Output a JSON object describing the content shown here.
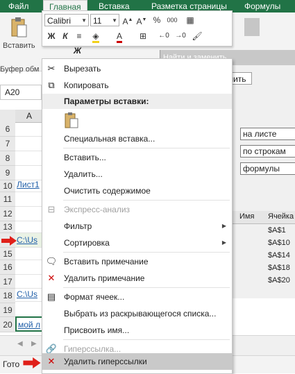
{
  "ribbon": {
    "tabs": [
      "Файл",
      "Главная",
      "Вставка",
      "Разметка страницы",
      "Формулы"
    ],
    "active_tab": "Главная",
    "paste_label": "Вставить",
    "clipboard_group": "Буфер обм"
  },
  "minibar": {
    "font_name": "Calibri",
    "font_size": "11",
    "bold": "Ж",
    "italic": "К",
    "italic2": "Ж",
    "percent": "%",
    "thousands": "000"
  },
  "namebox": {
    "value": "A20"
  },
  "dialog": {
    "title": "Найти и заменить",
    "tab_replace": "нить",
    "field_within": "на листе",
    "field_search": "по строкам",
    "field_lookin": "формулы",
    "col_name": "Имя",
    "col_cell": "Ячейка",
    "results": [
      "$A$1",
      "$A$10",
      "$A$14",
      "$A$18",
      "$A$20"
    ]
  },
  "grid": {
    "col_header": "A",
    "rows": [
      {
        "num": "6",
        "text": ""
      },
      {
        "num": "7",
        "text": ""
      },
      {
        "num": "8",
        "text": ""
      },
      {
        "num": "9",
        "text": ""
      },
      {
        "num": "10",
        "text": "Лист1"
      },
      {
        "num": "11",
        "text": ""
      },
      {
        "num": "12",
        "text": ""
      },
      {
        "num": "13",
        "text": ""
      },
      {
        "num": "14",
        "text": "C:\\Us"
      },
      {
        "num": "15",
        "text": ""
      },
      {
        "num": "16",
        "text": ""
      },
      {
        "num": "17",
        "text": ""
      },
      {
        "num": "18",
        "text": "C:\\Us"
      },
      {
        "num": "19",
        "text": ""
      },
      {
        "num": "20",
        "text": "мой л"
      }
    ]
  },
  "menu": {
    "cut": "Вырезать",
    "copy": "Копировать",
    "paste_options": "Параметры вставки:",
    "paste_special": "Специальная вставка...",
    "insert": "Вставить...",
    "delete": "Удалить...",
    "clear": "Очистить содержимое",
    "quick_analysis": "Экспресс-анализ",
    "filter": "Фильтр",
    "sort": "Сортировка",
    "insert_comment": "Вставить примечание",
    "delete_comment": "Удалить примечание",
    "format_cells": "Формат ячеек...",
    "pick_list": "Выбрать из раскрывающегося списка...",
    "define_name": "Присвоить имя...",
    "hyperlink": "Гиперссылка...",
    "remove_hyperlinks": "Удалить гиперссылки"
  },
  "status": {
    "text": "Гото"
  },
  "colors": {
    "excel_green": "#217346",
    "highlight": "#c9c9c9",
    "link": "#1f5ea8",
    "arrow_red": "#e0201a"
  },
  "icons": [
    "paste-icon",
    "cut-icon",
    "copy-icon",
    "clipboard-paste-icon",
    "quick-analysis-icon",
    "insert-comment-icon",
    "delete-comment-icon",
    "format-cells-icon",
    "hyperlink-icon",
    "remove-hyperlink-icon"
  ]
}
